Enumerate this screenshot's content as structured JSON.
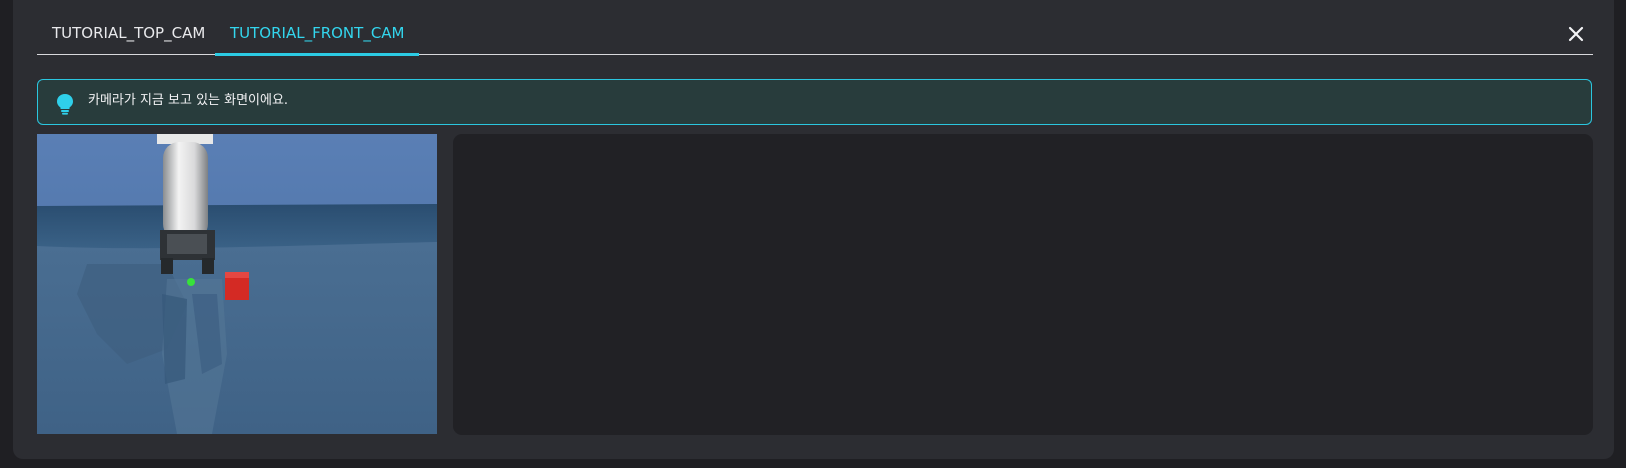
{
  "tabs": [
    {
      "label": "TUTORIAL_TOP_CAM",
      "active": false
    },
    {
      "label": "TUTORIAL_FRONT_CAM",
      "active": true
    }
  ],
  "close_icon": "close-icon",
  "info": {
    "icon": "lightbulb-icon",
    "text": "카메라가 지금 보고 있는 화면이에요."
  },
  "colors": {
    "accent": "#2ccbe4",
    "panel": "#2c2d32",
    "info_bg": "#283c3c",
    "object": "#d42a24",
    "target_marker": "#37e23a"
  }
}
